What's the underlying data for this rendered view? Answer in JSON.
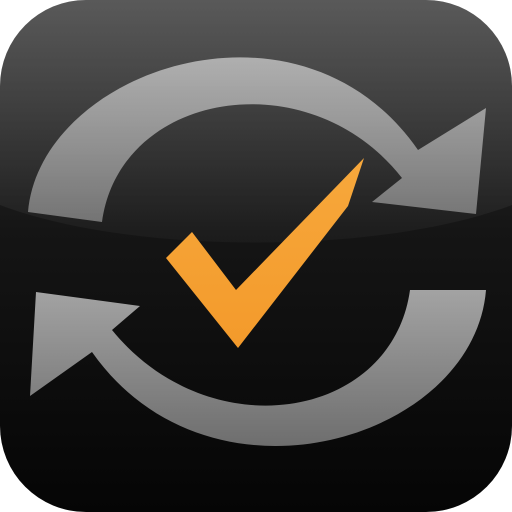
{
  "icon": {
    "name": "sync-check-app-icon",
    "symbols": [
      "refresh-arrows-icon",
      "checkmark-icon"
    ],
    "colors": {
      "background_top": "#3a3a3a",
      "background_bottom": "#050505",
      "arrows": "#8e8e8e",
      "checkmark": "#f39a2b"
    }
  }
}
